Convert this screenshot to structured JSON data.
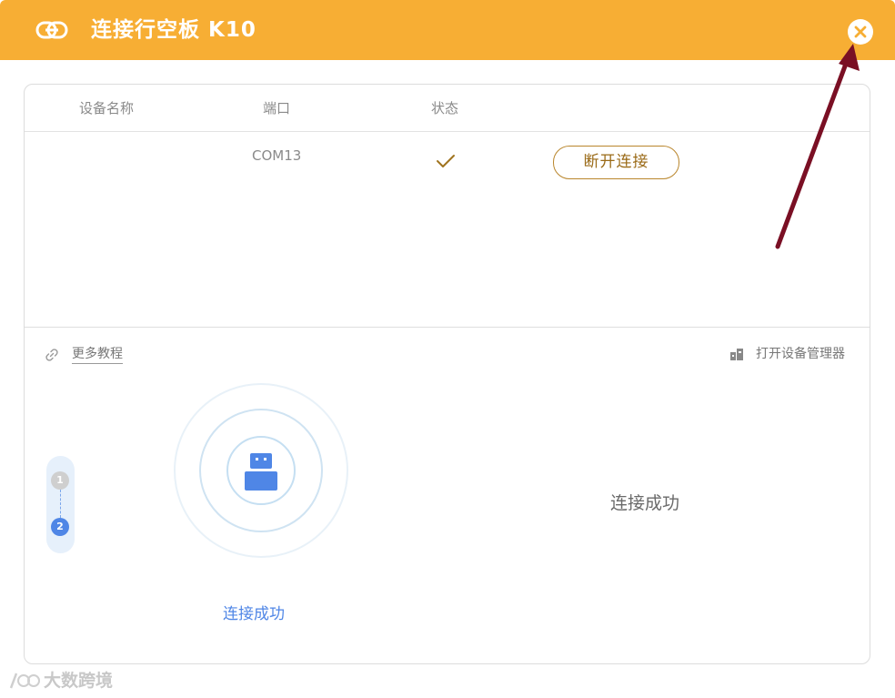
{
  "window": {
    "title": "连接行空板 K10",
    "header_color": "#f7ae34",
    "close_icon": "close-icon"
  },
  "table": {
    "headers": [
      "设备名称",
      "端口",
      "状态"
    ],
    "rows": [
      {
        "device_name": "",
        "port": "COM13",
        "status_icon": "checkmark-icon",
        "action_label": "断开连接"
      }
    ]
  },
  "footer_links": {
    "more_tutorials": "更多教程",
    "open_device_manager": "打开设备管理器"
  },
  "steps": {
    "items": [
      "1",
      "2"
    ],
    "active": 2
  },
  "connection": {
    "caption": "连接成功",
    "message": "连接成功",
    "accent_color": "#4f86e6"
  },
  "annotation": {
    "arrow_color": "#7a0f24"
  },
  "watermark": {
    "text": "大数跨境"
  }
}
